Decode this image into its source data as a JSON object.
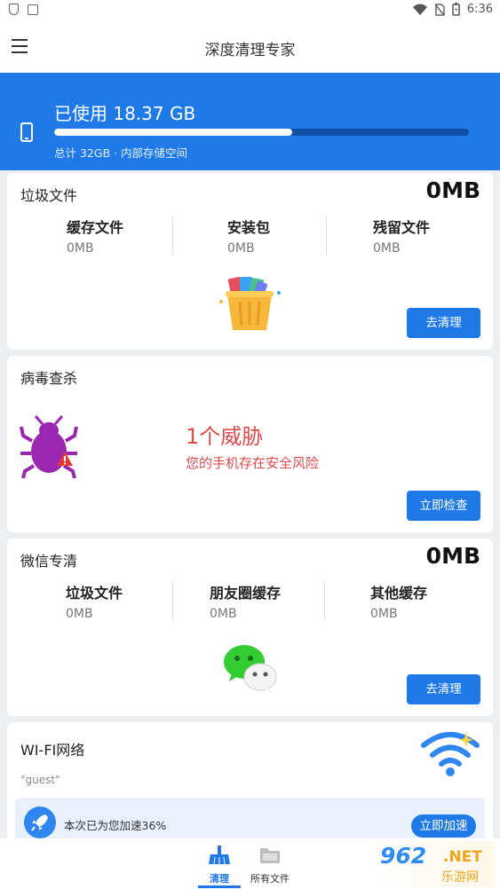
{
  "status_bar": {
    "time": "6:36"
  },
  "app_bar": {
    "title": "深度清理专家"
  },
  "storage": {
    "used_text": "已使用 18.37 GB",
    "total_text": "总计 32GB · 内部存储空间",
    "used_fraction": 0.574
  },
  "junk_card": {
    "title": "垃圾文件",
    "amount": "0MB",
    "stats": [
      {
        "label": "缓存文件",
        "value": "0MB"
      },
      {
        "label": "安装包",
        "value": "0MB"
      },
      {
        "label": "残留文件",
        "value": "0MB"
      }
    ],
    "button": "去清理"
  },
  "virus_card": {
    "title": "病毒查杀",
    "threat_count": "1个威胁",
    "threat_desc": "您的手机存在安全风险",
    "button": "立即检查"
  },
  "wechat_card": {
    "title": "微信专清",
    "amount": "0MB",
    "stats": [
      {
        "label": "垃圾文件",
        "value": "0MB"
      },
      {
        "label": "朋友圈缓存",
        "value": "0MB"
      },
      {
        "label": "其他缓存",
        "value": "0MB"
      }
    ],
    "button": "去清理"
  },
  "wifi_card": {
    "title": "WI-FI网络",
    "ssid": "\"guest\"",
    "speed_text": "本次已为您加速36%",
    "button": "立即加速"
  },
  "bottom_nav": {
    "items": [
      {
        "label": "清理",
        "icon": "broom-icon",
        "active": true
      },
      {
        "label": "所有文件",
        "icon": "folder-icon",
        "active": false
      }
    ]
  },
  "watermark": {
    "big": "962",
    "net": ".NET",
    "sub": "乐游网"
  },
  "colors": {
    "primary": "#1f7ae8",
    "danger": "#e34a4a",
    "background": "#eceff2"
  }
}
